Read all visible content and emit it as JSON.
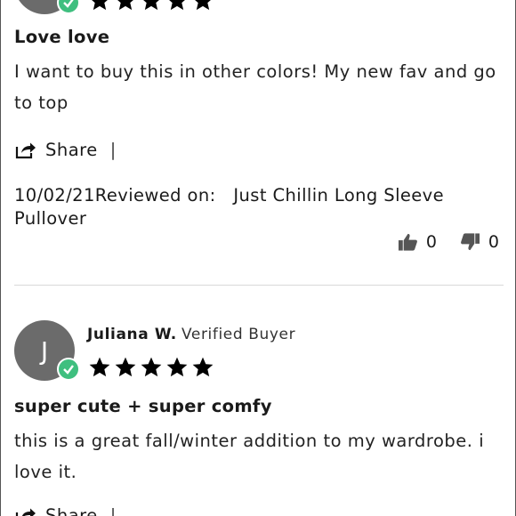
{
  "reviews": [
    {
      "avatar_letter": "",
      "rating": 5,
      "title": "Love love",
      "body": "I want to buy this in other colors! My new fav and go to top",
      "share_label": "Share",
      "separator": "|",
      "date": "10/02/21",
      "reviewed_on_label": "Reviewed on:",
      "product": "Just Chillin Long Sleeve Pullover",
      "helpful_count": "0",
      "unhelpful_count": "0"
    },
    {
      "avatar_letter": "J",
      "name": "Juliana W.",
      "badge": "Verified Buyer",
      "rating": 5,
      "title": "super cute + super comfy",
      "body": "this is a great fall/winter addition to my wardrobe. i love it.",
      "share_label": "Share",
      "separator": "|"
    }
  ],
  "colors": {
    "avatar": "#6b6b6b",
    "verified_check": "#3fbf7f",
    "icon": "#555555"
  }
}
